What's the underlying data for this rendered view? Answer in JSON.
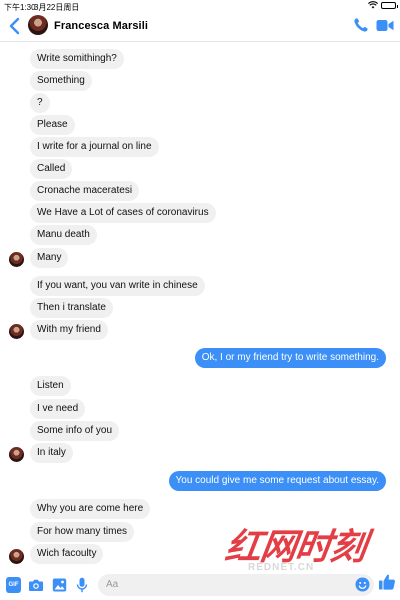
{
  "status_bar": {
    "time": "下午1:30",
    "date": "3月22日周日"
  },
  "header": {
    "contact_name": "Francesca Marsili"
  },
  "messages": [
    {
      "text": "Write somithingh?"
    },
    {
      "text": "Something"
    },
    {
      "text": "?"
    },
    {
      "text": "Please"
    },
    {
      "text": "I write for a journal on line"
    },
    {
      "text": "Called"
    },
    {
      "text": "Cronache maceratesi"
    },
    {
      "text": "We Have a Lot of cases of coronavirus"
    },
    {
      "text": "Manu death"
    },
    {
      "text": "Many"
    },
    {
      "text": "If you want, you van write in chinese"
    },
    {
      "text": "Then i translate"
    },
    {
      "text": "With my friend"
    },
    {
      "text": "Ok, I or my friend try to write something."
    },
    {
      "text": "Listen"
    },
    {
      "text": "I ve need"
    },
    {
      "text": "Some info of you"
    },
    {
      "text": "In italy"
    },
    {
      "text": "You could give me some request about essay."
    },
    {
      "text": "Why you are come here"
    },
    {
      "text": "For how many times"
    },
    {
      "text": "Wich facoulty"
    }
  ],
  "composer": {
    "gif_label": "GIF",
    "placeholder": "Aa"
  },
  "watermark": {
    "main": "红网时刻",
    "sub": "REDNET.CN"
  },
  "colors": {
    "accent": "#3b8ff6",
    "incoming_bubble": "#f0f0f0",
    "watermark_red": "#e0242c"
  },
  "icons": [
    "back-arrow-icon",
    "phone-icon",
    "video-camera-icon",
    "camera-icon",
    "image-icon",
    "microphone-icon",
    "emoji-icon",
    "thumbs-up-icon",
    "wifi-icon",
    "battery-icon"
  ]
}
